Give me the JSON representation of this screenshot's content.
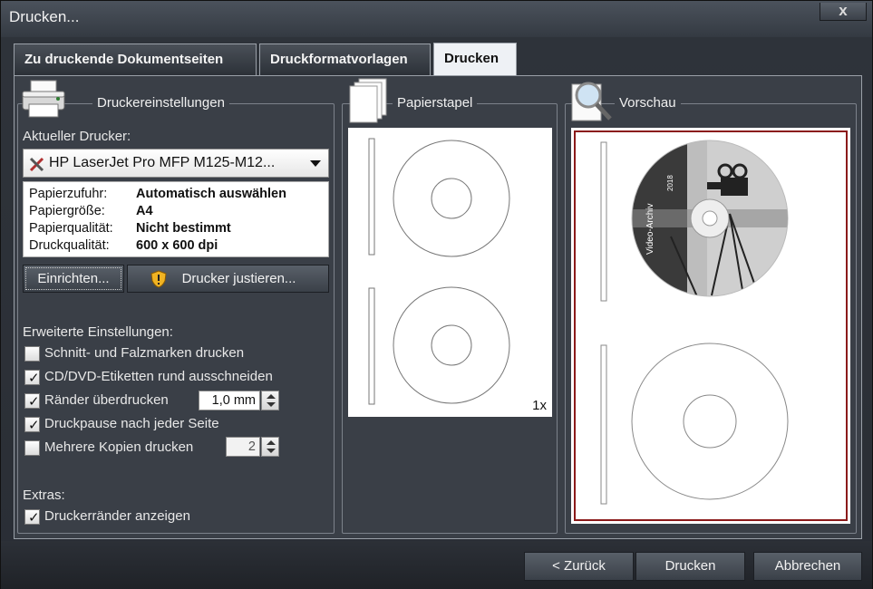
{
  "window": {
    "title": "Drucken...",
    "close_label": "x"
  },
  "tabs": [
    {
      "label": "Zu druckende Dokumentseiten"
    },
    {
      "label": "Druckformatvorlagen"
    },
    {
      "label": "Drucken"
    }
  ],
  "printer_settings": {
    "group_title": "Druckereinstellungen",
    "current_printer_label": "Aktueller Drucker:",
    "printer_name": "HP LaserJet Pro MFP M125-M12...",
    "info": [
      {
        "key": "Papierzufuhr:",
        "value": "Automatisch auswählen"
      },
      {
        "key": "Papiergröße:",
        "value": "A4"
      },
      {
        "key": "Papierqualität:",
        "value": "Nicht bestimmt"
      },
      {
        "key": "Druckqualität:",
        "value": "600 x 600 dpi"
      }
    ],
    "setup_button": "Einrichten...",
    "adjust_button": "Drucker justieren..."
  },
  "advanced": {
    "heading": "Erweiterte Einstellungen:",
    "options": [
      {
        "label": "Schnitt- und Falzmarken drucken",
        "checked": false
      },
      {
        "label": "CD/DVD-Etiketten rund ausschneiden",
        "checked": true
      },
      {
        "label": "Ränder überdrucken",
        "checked": true
      },
      {
        "label": "Druckpause nach jeder Seite",
        "checked": true
      },
      {
        "label": "Mehrere Kopien drucken",
        "checked": false
      }
    ],
    "margin_value": "1,0 mm",
    "copies_value": "2"
  },
  "extras": {
    "heading": "Extras:",
    "options": [
      {
        "label": "Druckerränder anzeigen",
        "checked": true
      }
    ]
  },
  "paper_stack": {
    "group_title": "Papierstapel",
    "count_label": "1x"
  },
  "preview": {
    "group_title": "Vorschau",
    "disc_text": "Video-Archiv",
    "disc_year": "2018"
  },
  "footer": {
    "back_button": "< Zurück",
    "print_button": "Drucken",
    "cancel_button": "Abbrechen"
  },
  "colors": {
    "background": "#2b2f36",
    "active_tab": "#eef1f5",
    "preview_border": "#8b1a1a"
  }
}
